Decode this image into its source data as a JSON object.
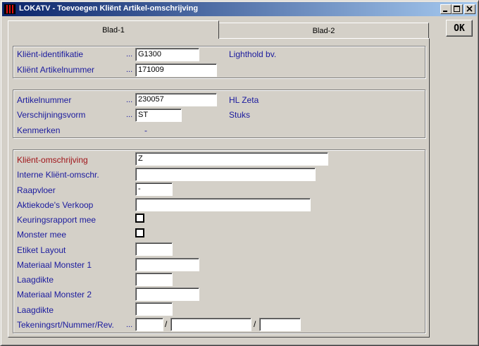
{
  "window": {
    "title": "LOKATV - Toevoegen Kliënt Artikel-omschrijving",
    "ok_label": "OK"
  },
  "tabs": [
    {
      "label": "Blad-1"
    },
    {
      "label": "Blad-2"
    }
  ],
  "group1": {
    "client_id_label": "Kliënt-identifikatie",
    "client_id_value": "G1300",
    "client_name": "Lighthold bv.",
    "client_article_label": "Kliënt Artikelnummer",
    "client_article_value": "171009"
  },
  "group2": {
    "article_label": "Artikelnummer",
    "article_value": "230057",
    "article_name": "HL Zeta",
    "appearance_label": "Verschijningsvorm",
    "appearance_value": "ST",
    "appearance_name": "Stuks",
    "features_label": "Kenmerken",
    "features_value": "-"
  },
  "group3": {
    "client_desc_label": "Kliënt-omschrijving",
    "client_desc_value": "Z",
    "internal_desc_label": "Interne Kliënt-omschr.",
    "internal_desc_value": "",
    "pick_floor_label": "Raapvloer",
    "pick_floor_value": "-",
    "action_codes_label": "Aktiekode's Verkoop",
    "action_codes_value": "",
    "inspection_label": "Keuringsrapport mee",
    "sample_label": "Monster mee",
    "label_layout_label": "Etiket Layout",
    "label_layout_value": "",
    "material1_label": "Materiaal Monster 1",
    "material1_value": "",
    "thickness1_label": "Laagdikte",
    "thickness1_value": "",
    "material2_label": "Materiaal Monster 2",
    "material2_value": "",
    "thickness2_label": "Laagdikte",
    "thickness2_value": "",
    "drawing_label": "Tekeningsrt/Nummer/Rev.",
    "drawing_type_value": "",
    "drawing_number_value": "",
    "drawing_rev_value": "",
    "separator": "/"
  },
  "dots": "..."
}
